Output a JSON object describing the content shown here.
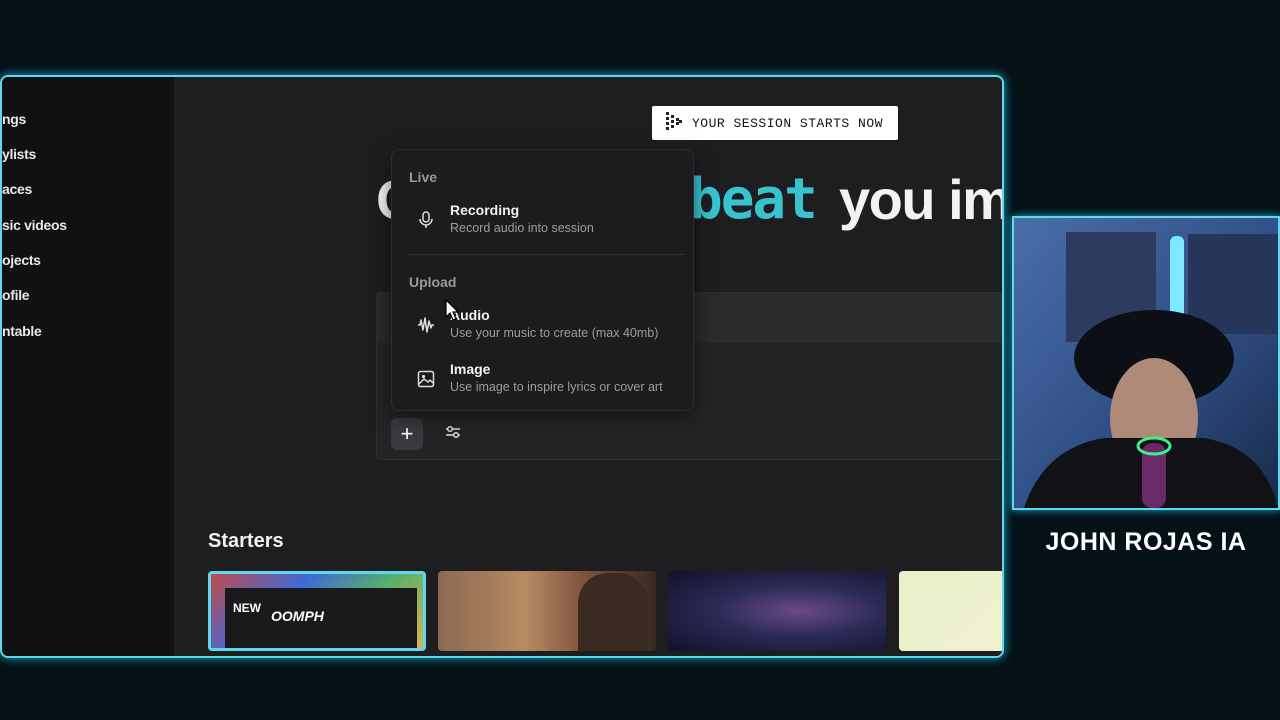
{
  "sidebar": {
    "items": [
      {
        "label": "ngs"
      },
      {
        "label": "ylists"
      },
      {
        "label": "aces"
      },
      {
        "label": "sic videos"
      },
      {
        "label": "ojects"
      },
      {
        "label": "ofile"
      },
      {
        "label": "ntable"
      }
    ]
  },
  "session_badge": {
    "label": "YOUR SESSION STARTS NOW",
    "icon": "play-dots-icon"
  },
  "hero": {
    "first": "C",
    "beat": "beat",
    "rest": "you im"
  },
  "dropdown": {
    "live_section": "Live",
    "recording": {
      "title": "Recording",
      "desc": "Record audio into session",
      "icon": "microphone-icon"
    },
    "upload_section": "Upload",
    "audio": {
      "title": "Audio",
      "desc": "Use your music to create (max 40mb)",
      "icon": "waveform-icon"
    },
    "image": {
      "title": "Image",
      "desc": "Use image to inspire lyrics or cover art",
      "icon": "image-icon"
    }
  },
  "prompt": {
    "plus_icon": "plus-icon",
    "settings_icon": "sliders-icon"
  },
  "starters": {
    "title": "Starters",
    "cards": [
      {
        "badge": "NEW",
        "label": "OOMPH"
      },
      {
        "label": ""
      },
      {
        "label": ""
      },
      {
        "label": ""
      }
    ]
  },
  "streamer": {
    "name": "JOHN ROJAS IA"
  },
  "colors": {
    "accent_cyan": "#38c4cf",
    "frame_glow": "#5fd7ee",
    "background": "#041217"
  }
}
